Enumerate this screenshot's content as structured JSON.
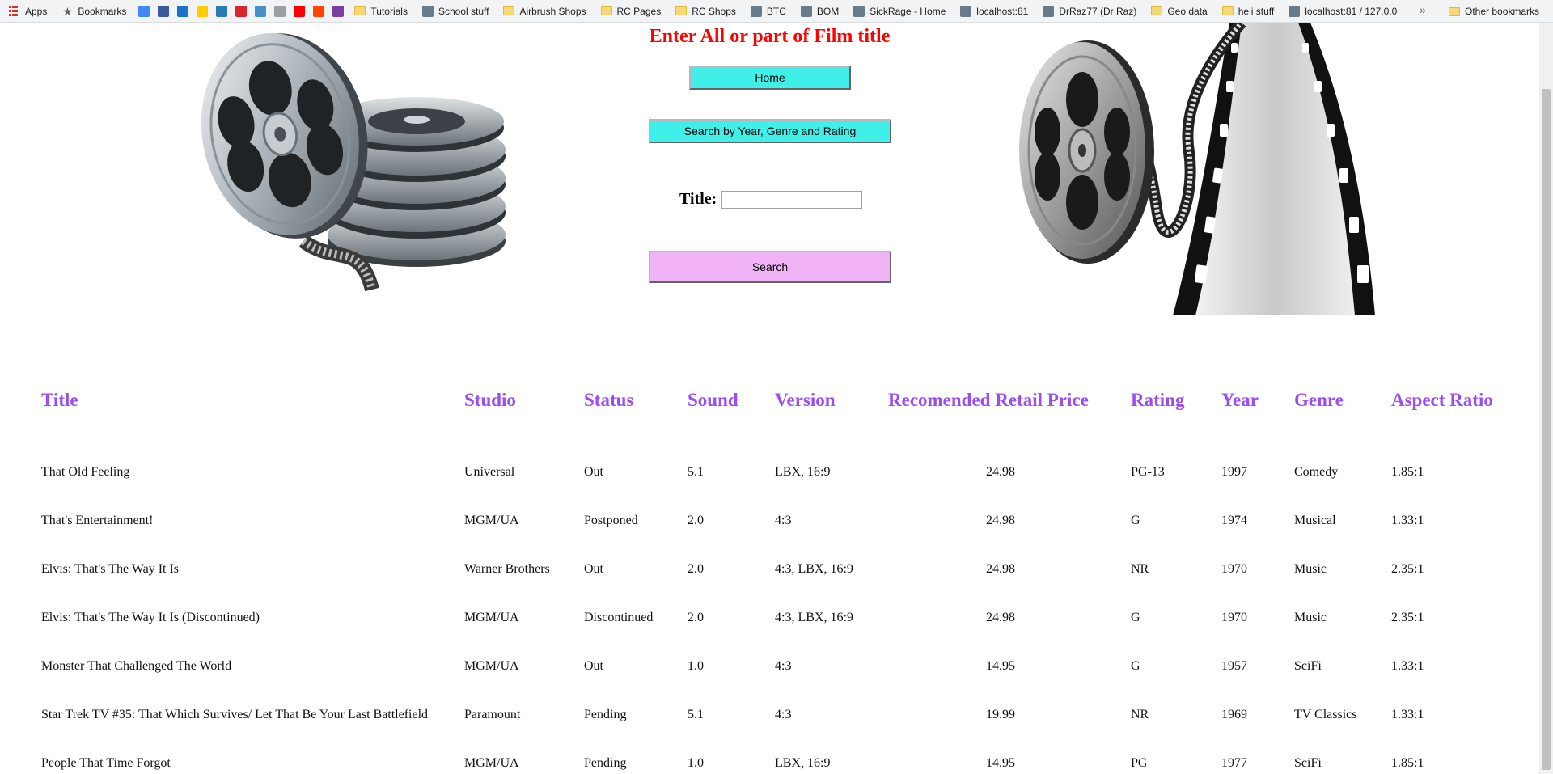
{
  "bookmarks_bar": {
    "items": [
      {
        "label": "Apps",
        "icon": "apps-grid-icon"
      },
      {
        "label": "Bookmarks",
        "icon": "star-icon"
      },
      {
        "label": "",
        "icon": "google-icon",
        "color": "#4285f4"
      },
      {
        "label": "",
        "icon": "facebook-icon",
        "color": "#3b5998"
      },
      {
        "label": "",
        "icon": "bank-icon",
        "color": "#1a73c9"
      },
      {
        "label": "",
        "icon": "commbank-icon",
        "color": "#ffcc00"
      },
      {
        "label": "",
        "icon": "bank-statement-icon",
        "color": "#2a7ab8"
      },
      {
        "label": "",
        "icon": "red-shield-icon",
        "color": "#d6262b"
      },
      {
        "label": "",
        "icon": "tools-icon",
        "color": "#4a90c8"
      },
      {
        "label": "",
        "icon": "photo-icon",
        "color": "#9aa0a6"
      },
      {
        "label": "",
        "icon": "youtube-icon",
        "color": "#ff0000"
      },
      {
        "label": "",
        "icon": "reddit-icon",
        "color": "#ff4500"
      },
      {
        "label": "",
        "icon": "purple-app-icon",
        "color": "#7b3fa0"
      },
      {
        "label": "Tutorials",
        "icon": "folder-icon"
      },
      {
        "label": "School stuff",
        "icon": "school-icon"
      },
      {
        "label": "Airbrush Shops",
        "icon": "folder-icon"
      },
      {
        "label": "RC Pages",
        "icon": "folder-icon"
      },
      {
        "label": "RC Shops",
        "icon": "folder-icon"
      },
      {
        "label": "BTC",
        "icon": "btc-icon"
      },
      {
        "label": "BOM",
        "icon": "bom-icon"
      },
      {
        "label": "SickRage - Home",
        "icon": "sickrage-icon"
      },
      {
        "label": "localhost:81",
        "icon": "localhost-icon"
      },
      {
        "label": "DrRaz77 (Dr Raz)",
        "icon": "github-icon"
      },
      {
        "label": "Geo data",
        "icon": "folder-icon"
      },
      {
        "label": "heli stuff",
        "icon": "folder-icon"
      },
      {
        "label": "localhost:81 / 127.0.0",
        "icon": "phpmyadmin-icon"
      }
    ],
    "more": "»",
    "other_bookmarks": "Other bookmarks"
  },
  "header": {
    "heading": "Enter All or part of Film title",
    "home_button": "Home",
    "advanced_search_button": "Search by Year, Genre and Rating",
    "title_label": "Title:",
    "title_input_value": "",
    "search_button": "Search"
  },
  "results": {
    "columns": [
      "Title",
      "Studio",
      "Status",
      "Sound",
      "Version",
      "Recomended Retail Price",
      "Rating",
      "Year",
      "Genre",
      "Aspect Ratio"
    ],
    "rows": [
      [
        "That Old Feeling",
        "Universal",
        "Out",
        "5.1",
        "LBX, 16:9",
        "24.98",
        "PG-13",
        "1997",
        "Comedy",
        "1.85:1"
      ],
      [
        "That's Entertainment!",
        "MGM/UA",
        "Postponed",
        "2.0",
        "4:3",
        "24.98",
        "G",
        "1974",
        "Musical",
        "1.33:1"
      ],
      [
        "Elvis: That's The Way It Is",
        "Warner Brothers",
        "Out",
        "2.0",
        "4:3, LBX, 16:9",
        "24.98",
        "NR",
        "1970",
        "Music",
        "2.35:1"
      ],
      [
        "Elvis: That's The Way It Is (Discontinued)",
        "MGM/UA",
        "Discontinued",
        "2.0",
        "4:3, LBX, 16:9",
        "24.98",
        "G",
        "1970",
        "Music",
        "2.35:1"
      ],
      [
        "Monster That Challenged The World",
        "MGM/UA",
        "Out",
        "1.0",
        "4:3",
        "14.95",
        "G",
        "1957",
        "SciFi",
        "1.33:1"
      ],
      [
        "Star Trek TV #35: That Which Survives/ Let That Be Your Last Battlefield",
        "Paramount",
        "Pending",
        "5.1",
        "4:3",
        "19.99",
        "NR",
        "1969",
        "TV Classics",
        "1.33:1"
      ],
      [
        "People That Time Forgot",
        "MGM/UA",
        "Pending",
        "1.0",
        "LBX, 16:9",
        "14.95",
        "PG",
        "1977",
        "SciFi",
        "1.85:1"
      ]
    ]
  },
  "colors": {
    "heading": "#ff0000",
    "column_header": "#9a4df2",
    "nav_button": "#40f0e8",
    "search_button": "#f0b4f6"
  }
}
